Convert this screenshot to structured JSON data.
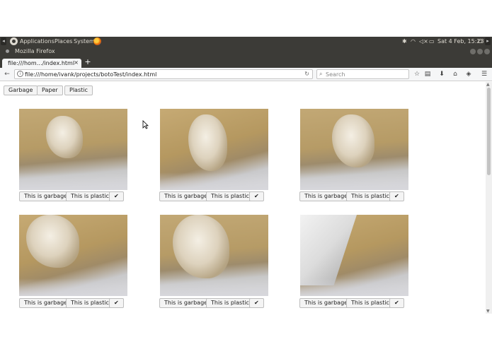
{
  "top_panel": {
    "menus": [
      "Applications",
      "Places",
      "System"
    ],
    "datetime": "Sat 4 Feb, 15:23"
  },
  "window": {
    "title": "Mozilla Firefox"
  },
  "tab": {
    "title": "file:///hom…/index.html",
    "close": "×",
    "new_tab": "+"
  },
  "nav": {
    "url": "file:///home/ivank/projects/botoTest/index.html",
    "search_placeholder": "Search"
  },
  "page": {
    "categories": [
      "Garbage",
      "Paper",
      "Plastic"
    ],
    "item_buttons": {
      "garbage_label": "This is garbage",
      "plastic_label": "This is plastic",
      "confirm_label": "✔"
    },
    "items": [
      {
        "subject": "crumpled paper"
      },
      {
        "subject": "crumpled paper"
      },
      {
        "subject": "crumpled paper"
      },
      {
        "subject": "crumpled paper"
      },
      {
        "subject": "crumpled paper"
      },
      {
        "subject": "paper roll"
      }
    ]
  }
}
